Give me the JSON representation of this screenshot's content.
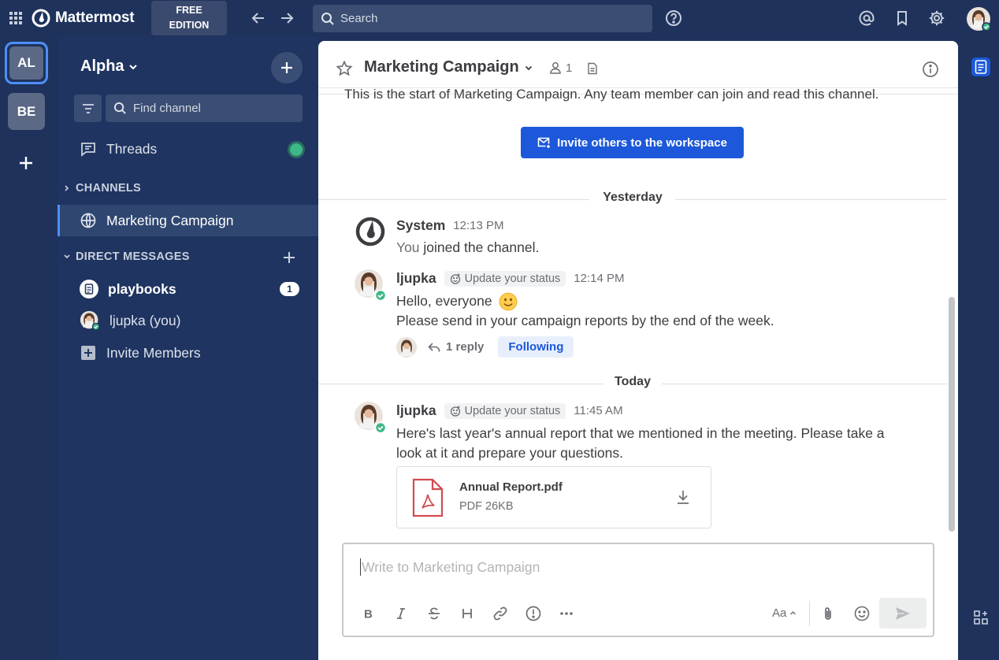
{
  "app": {
    "name": "Mattermost",
    "edition_line1": "FREE",
    "edition_line2": "EDITION",
    "search_placeholder": "Search"
  },
  "teams": [
    {
      "initials": "AL",
      "active": true
    },
    {
      "initials": "BE",
      "active": false
    }
  ],
  "sidebar": {
    "team_name": "Alpha",
    "find_channel_placeholder": "Find channel",
    "threads_label": "Threads",
    "channels_header": "CHANNELS",
    "channels": [
      {
        "label": "Marketing Campaign",
        "active": true
      }
    ],
    "dm_header": "DIRECT MESSAGES",
    "direct_messages": [
      {
        "label": "playbooks",
        "unread": "1"
      },
      {
        "label": "ljupka (you)"
      }
    ],
    "invite_members": "Invite Members"
  },
  "channel": {
    "title": "Marketing Campaign",
    "member_count": "1",
    "intro_text": "This is the start of Marketing Campaign. Any team member can join and read this channel.",
    "invite_button": "Invite others to the workspace"
  },
  "dividers": {
    "yesterday": "Yesterday",
    "today": "Today"
  },
  "posts": [
    {
      "author": "System",
      "time": "12:13 PM",
      "text_prefix": "You ",
      "text_bold": "joined the channel."
    },
    {
      "author": "ljupka",
      "status_chip": "Update your status",
      "time": "12:14 PM",
      "line1": "Hello, everyone",
      "line2": "Please send in your campaign reports by the end of the week.",
      "reply_count": "1 reply",
      "following": "Following"
    },
    {
      "author": "ljupka",
      "status_chip": "Update your status",
      "time": "11:45 AM",
      "line1": "Here's last year's annual report that we mentioned in the meeting. Please take a",
      "line2": "look at it and prepare your questions.",
      "attachment": {
        "name": "Annual Report.pdf",
        "meta": "PDF 26KB"
      }
    }
  ],
  "composer": {
    "placeholder": "Write to Marketing Campaign",
    "font_toggle": "Aa"
  },
  "colors": {
    "sidebar_bg": "#1e325c",
    "accent": "#1c58d9",
    "online": "#3db887",
    "pdf_red": "#d24b4e"
  }
}
